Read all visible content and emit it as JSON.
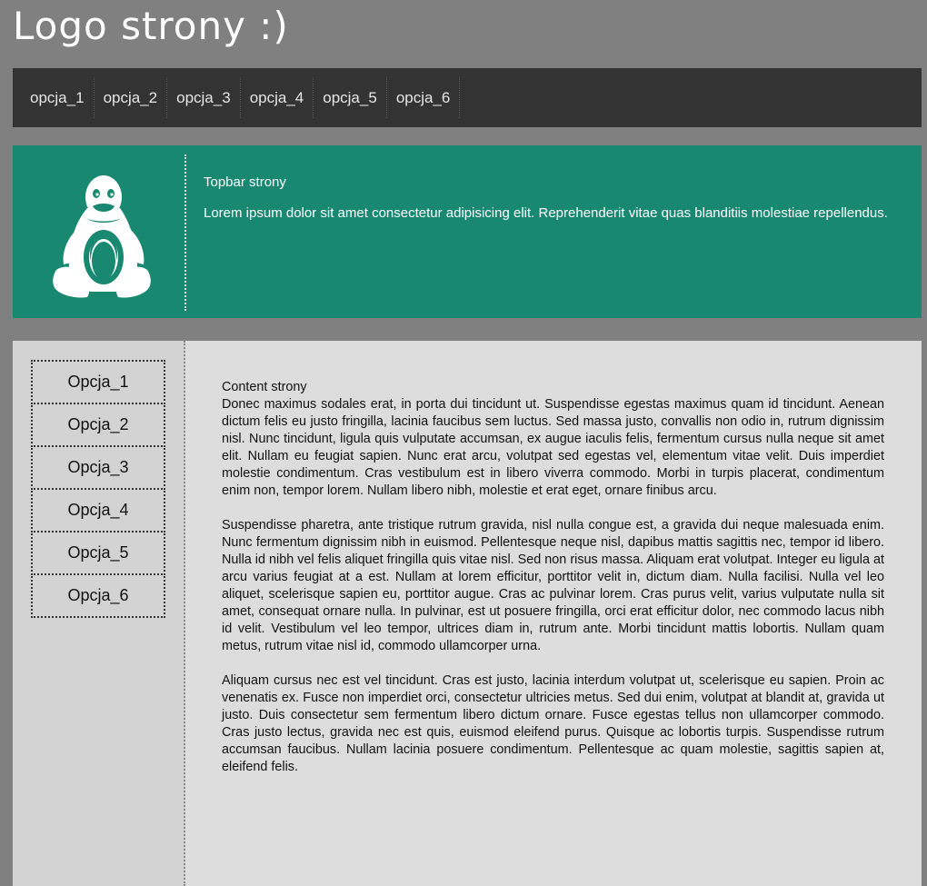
{
  "header": {
    "logo_text": "Logo strony :)"
  },
  "nav": {
    "items": [
      "opcja_1",
      "opcja_2",
      "opcja_3",
      "opcja_4",
      "opcja_5",
      "opcja_6"
    ]
  },
  "topbar": {
    "icon": "tux-penguin-icon",
    "title": "Topbar strony",
    "description": "Lorem ipsum dolor sit amet consectetur adipisicing elit. Reprehenderit vitae quas blanditiis molestiae repellendus."
  },
  "sidebar": {
    "items": [
      "Opcja_1",
      "Opcja_2",
      "Opcja_3",
      "Opcja_4",
      "Opcja_5",
      "Opcja_6"
    ]
  },
  "content": {
    "title": "Content strony",
    "paragraphs": [
      "Donec maximus sodales erat, in porta dui tincidunt ut. Suspendisse egestas maximus quam id tincidunt. Aenean dictum felis eu justo fringilla, lacinia faucibus sem luctus. Sed massa justo, convallis non odio in, rutrum dignissim nisl. Nunc tincidunt, ligula quis vulputate accumsan, ex augue iaculis felis, fermentum cursus nulla neque sit amet elit. Nullam eu feugiat sapien. Nunc erat arcu, volutpat sed egestas vel, elementum vitae velit. Duis imperdiet molestie condimentum. Cras vestibulum est in libero viverra commodo. Morbi in turpis placerat, condimentum enim non, tempor lorem. Nullam libero nibh, molestie et erat eget, ornare finibus arcu.",
      "Suspendisse pharetra, ante tristique rutrum gravida, nisl nulla congue est, a gravida dui neque malesuada enim. Nunc fermentum dignissim nibh in euismod. Pellentesque neque nisl, dapibus mattis sagittis nec, tempor id libero. Nulla id nibh vel felis aliquet fringilla quis vitae nisl. Sed non risus massa. Aliquam erat volutpat. Integer eu ligula at arcu varius feugiat at a est. Nullam at lorem efficitur, porttitor velit in, dictum diam. Nulla facilisi. Nulla vel leo aliquet, scelerisque sapien eu, porttitor augue. Cras ac pulvinar lorem. Cras purus velit, varius vulputate nulla sit amet, consequat ornare nulla. In pulvinar, est ut posuere fringilla, orci erat efficitur dolor, nec commodo lacus nibh id velit. Vestibulum vel leo tempor, ultrices diam in, rutrum ante. Morbi tincidunt mattis lobortis. Nullam quam metus, rutrum vitae nisl id, commodo ullamcorper urna.",
      "Aliquam cursus nec est vel tincidunt. Cras est justo, lacinia interdum volutpat ut, scelerisque eu sapien. Proin ac venenatis ex. Fusce non imperdiet orci, consectetur ultricies metus. Sed dui enim, volutpat at blandit at, gravida ut justo. Duis consectetur sem fermentum libero dictum ornare. Fusce egestas tellus non ullamcorper commodo. Cras justo lectus, gravida nec est quis, euismod eleifend purus. Quisque ac lobortis turpis. Suspendisse rutrum accumsan faucibus. Nullam lacinia posuere condimentum. Pellentesque ac quam molestie, sagittis sapien at, eleifend felis."
    ]
  },
  "colors": {
    "page_bg": "#808080",
    "nav_bg": "#333333",
    "topbar_bg": "#188871",
    "sidebar_bg": "#d3d3d3",
    "content_bg": "#dddddd"
  }
}
